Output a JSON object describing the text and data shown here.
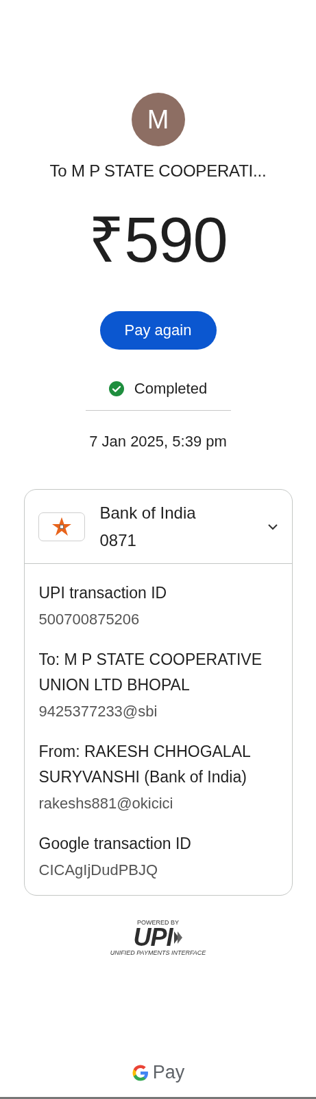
{
  "payee": {
    "avatar_letter": "M",
    "title": "To M P STATE COOPERATI...",
    "amount": "₹590"
  },
  "pay_again_button": "Pay again",
  "status": {
    "kind": "completed",
    "label": "Completed"
  },
  "date": "7 Jan 2025, 5:39 pm",
  "account_card": {
    "bank": "Bank of India",
    "account": "0871",
    "expanded": true,
    "details": [
      {
        "label": "UPI transaction ID",
        "value": "500700875206"
      },
      {
        "label": "To: M P STATE COOPERATIVE UNION LTD BHOPAL",
        "value": "9425377233@sbi"
      },
      {
        "label": "From: RAKESH CHHOGALAL SURYVANSHI (Bank of India)",
        "value": "rakeshs881@okicici"
      },
      {
        "label": "Google transaction ID",
        "value": "CICAgIjDudPBJQ"
      }
    ]
  },
  "upi_logo": {
    "top": "POWERED BY",
    "mark": "UPI",
    "bottom": "UNIFIED PAYMENTS INTERFACE"
  },
  "brand": "Pay"
}
